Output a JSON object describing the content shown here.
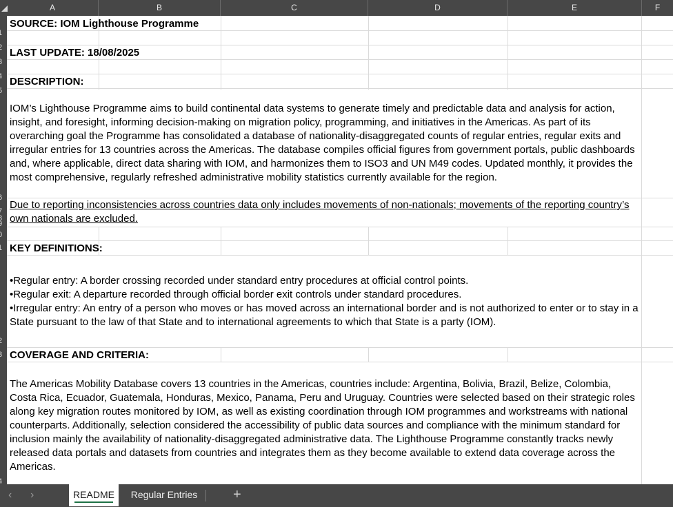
{
  "columns": [
    "A",
    "B",
    "C",
    "D",
    "E",
    "F"
  ],
  "rows": [
    "1",
    "2",
    "3",
    "4",
    "5",
    "6",
    "7",
    "8",
    "9",
    "0",
    "1",
    "2",
    "3",
    "4"
  ],
  "cells": {
    "source": "SOURCE: IOM Lighthouse Programme",
    "last_update": "LAST UPDATE: 18/08/2025",
    "description_heading": "DESCRIPTION:",
    "description_text": "IOM’s Lighthouse Programme aims to build continental data systems to generate timely and predictable data and analysis for action, insight, and foresight, informing decision-making on migration policy, programming, and initiatives in the Americas. As part of its overarching goal the Programme has consolidated a database of nationality-disaggregated counts of regular entries, regular exits and irregular entries for 13 countries across the Americas. The database compiles official figures from government portals, public dashboards and, where applicable, direct data sharing with IOM, and harmonizes them to ISO3 and UN M49 codes. Updated monthly, it provides the most comprehensive, regularly refreshed administrative mobility statistics currently available for the region.",
    "note_text": "Due to reporting inconsistencies across countries data only includes movements of non-nationals; movements of the reporting country’s own nationals are excluded.",
    "key_definitions_heading": "KEY DEFINITIONS:",
    "definitions": [
      "•Regular entry: A border crossing recorded under standard entry procedures at official control points.",
      "•Regular exit: A departure recorded through official border exit controls under standard procedures.",
      "•Irregular entry: An entry of a person who moves or has moved across an international border and is not authorized to enter or to stay in a State pursuant to the law of that State and to international agreements to which that State is a party (IOM)."
    ],
    "coverage_heading": "COVERAGE AND CRITERIA:",
    "coverage_text": "The Americas Mobility Database covers 13 countries in the Americas, countries include: Argentina, Bolivia, Brazil, Belize, Colombia, Costa Rica, Ecuador, Guatemala, Honduras, Mexico, Panama, Peru and Uruguay. Countries were selected based on their strategic roles along key migration routes monitored by IOM, as well as existing coordination through IOM programmes and workstreams with national counterparts. Additionally, selection considered the accessibility of public data sources and compliance with the minimum standard for inclusion mainly the availability of nationality-disaggregated administrative data. The Lighthouse Programme constantly tracks newly released data portals and datasets from countries and integrates them as they become available to extend data coverage across the Americas."
  },
  "sheet_tabs": [
    {
      "label": "README",
      "active": true
    },
    {
      "label": "Regular Entries",
      "active": false
    }
  ],
  "add_sheet_label": "+",
  "nav_prev": "‹",
  "nav_next": "›",
  "colors": {
    "header_bg": "#474747",
    "gridline": "#dadada",
    "active_tab_underline": "#1e7145"
  }
}
